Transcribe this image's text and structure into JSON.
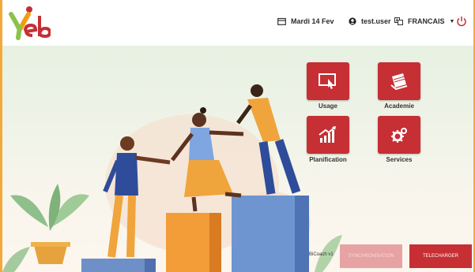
{
  "header": {
    "date": "Mardi 14 Fev",
    "user": "test.user",
    "language": "FRANCAIS"
  },
  "tiles": [
    {
      "label": "Usage",
      "icon": "touch-screen-icon"
    },
    {
      "label": "Academie",
      "icon": "books-icon"
    },
    {
      "label": "Planification",
      "icon": "growth-chart-icon"
    },
    {
      "label": "Services",
      "icon": "gears-icon"
    }
  ],
  "footer": {
    "version": "BiCoach v1",
    "sync_label": "SYNCHRONISATION",
    "download_label": "TELECHARGER"
  },
  "colors": {
    "accent": "#c62f34",
    "border": "#f3a93a"
  }
}
